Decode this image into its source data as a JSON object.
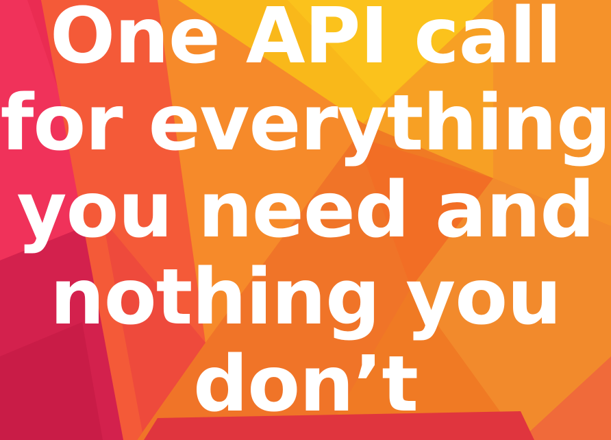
{
  "headline": {
    "lines": [
      "One API call",
      "for everything",
      "you need and",
      "nothing you",
      "don’t"
    ]
  },
  "colors": {
    "text": "#ffffff",
    "orange": "#f07a24",
    "yellow": "#f9b81a",
    "pink": "#e8284f",
    "magenta": "#d0204c"
  }
}
